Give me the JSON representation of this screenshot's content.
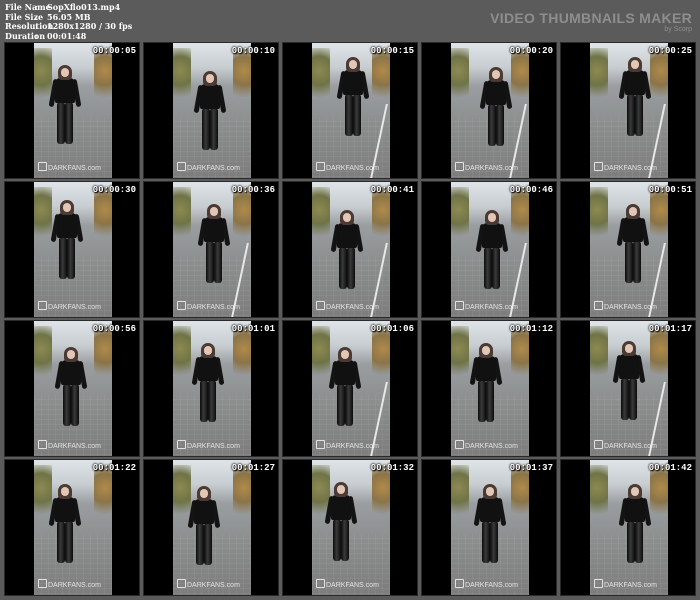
{
  "file_info": {
    "rows": [
      {
        "label": "File Name",
        "value": "SopXflo013.mp4"
      },
      {
        "label": "File Size",
        "value": "56.05 MB"
      },
      {
        "label": "Resolution",
        "value": "1280x1280 / 30 fps"
      },
      {
        "label": "Duration",
        "value": "00:01:48"
      }
    ],
    "separator": ":"
  },
  "brand": {
    "title": "VIDEO THUMBNAILS MAKER",
    "subtitle": "by Scorp"
  },
  "watermark": "DARKFANS.com",
  "timestamps": [
    "00:00:05",
    "00:00:10",
    "00:00:15",
    "00:00:20",
    "00:00:25",
    "00:00:30",
    "00:00:36",
    "00:00:41",
    "00:00:46",
    "00:00:51",
    "00:00:56",
    "00:01:01",
    "00:01:06",
    "00:01:12",
    "00:01:17",
    "00:01:22",
    "00:01:27",
    "00:01:32",
    "00:01:37",
    "00:01:42"
  ],
  "colors": {
    "background": "#5b5b5b",
    "letterbox": "#000000",
    "timestamp": "#ffffff"
  }
}
